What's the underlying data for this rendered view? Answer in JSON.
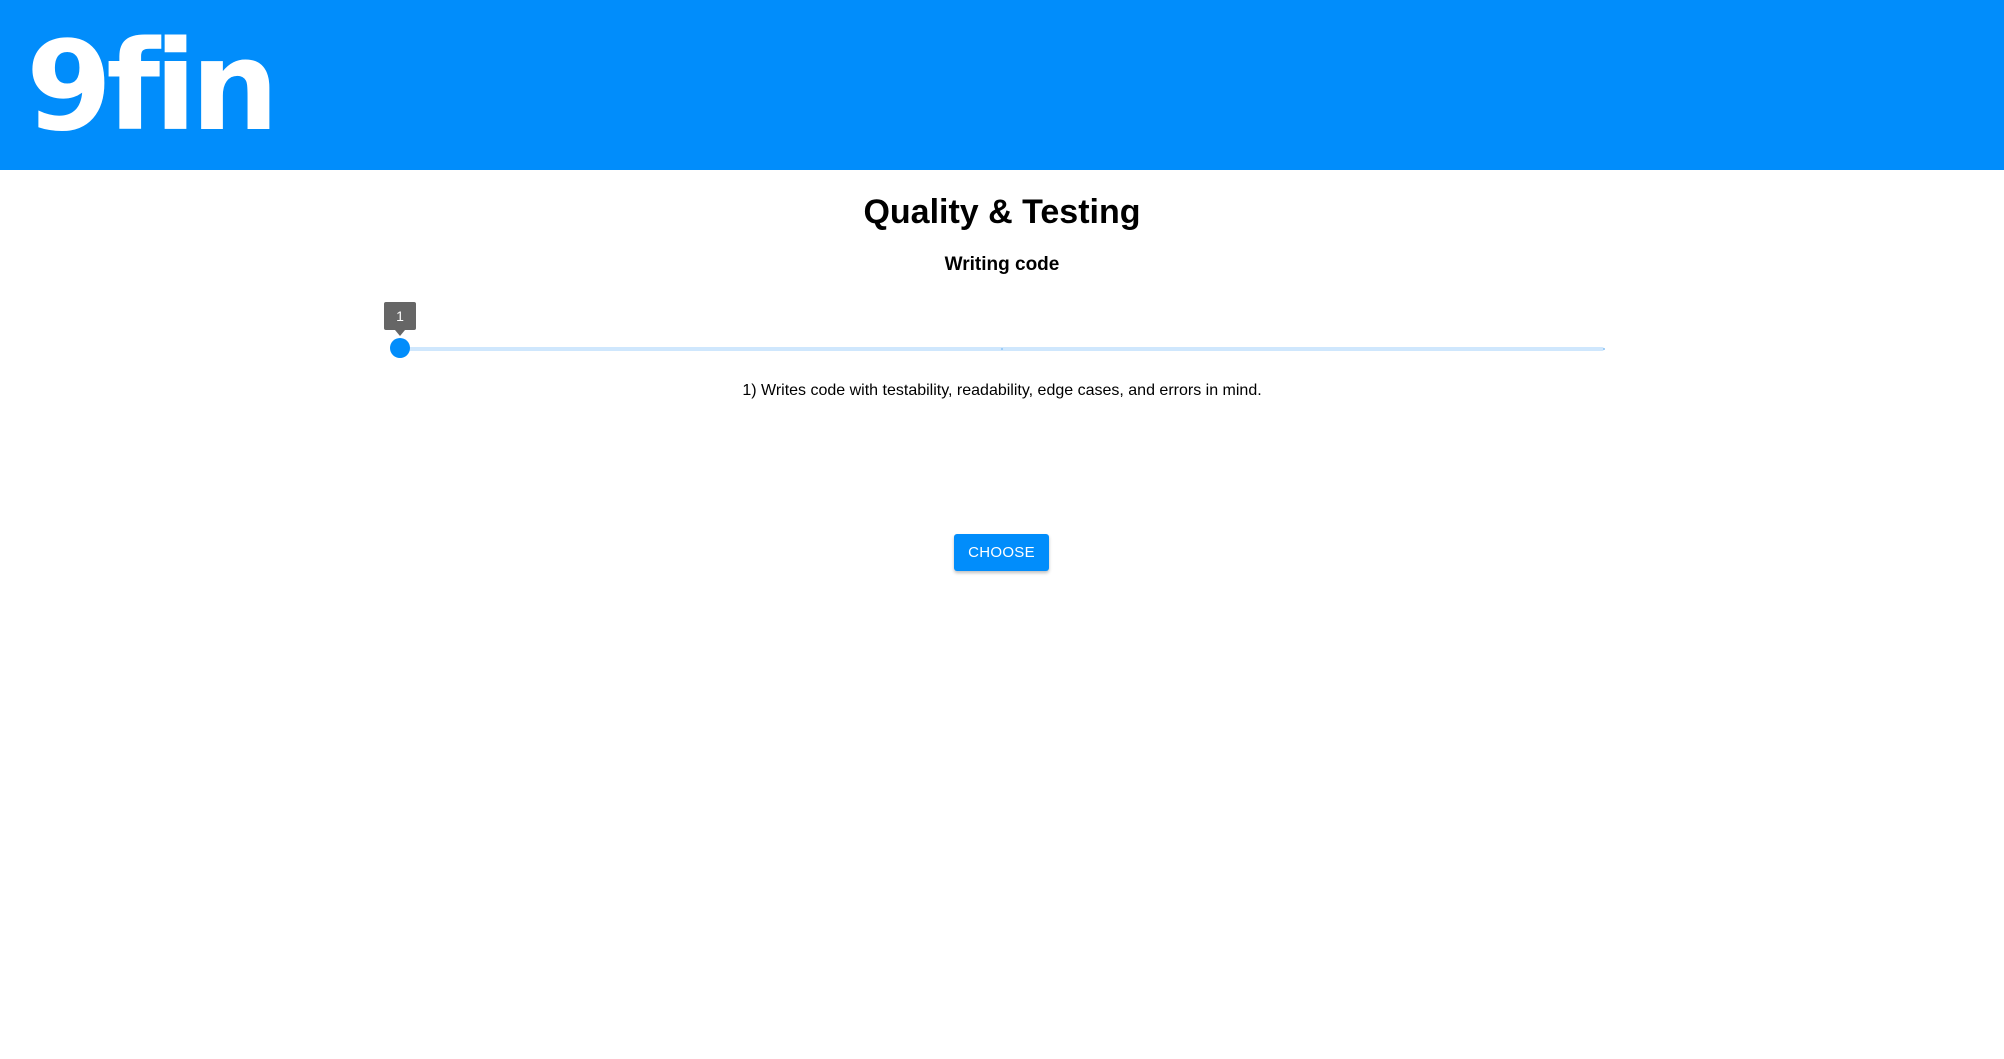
{
  "header": {
    "logo_text": "9fin",
    "background_color": "#018dfb"
  },
  "main": {
    "title": "Quality & Testing",
    "subtitle": "Writing code",
    "slider": {
      "value": 1,
      "value_label": "1",
      "min": 1,
      "max": 3,
      "accent_color": "#018dfb"
    },
    "description": "1) Writes code with testability, readability, edge cases, and errors in mind.",
    "choose_label": "CHOOSE"
  }
}
